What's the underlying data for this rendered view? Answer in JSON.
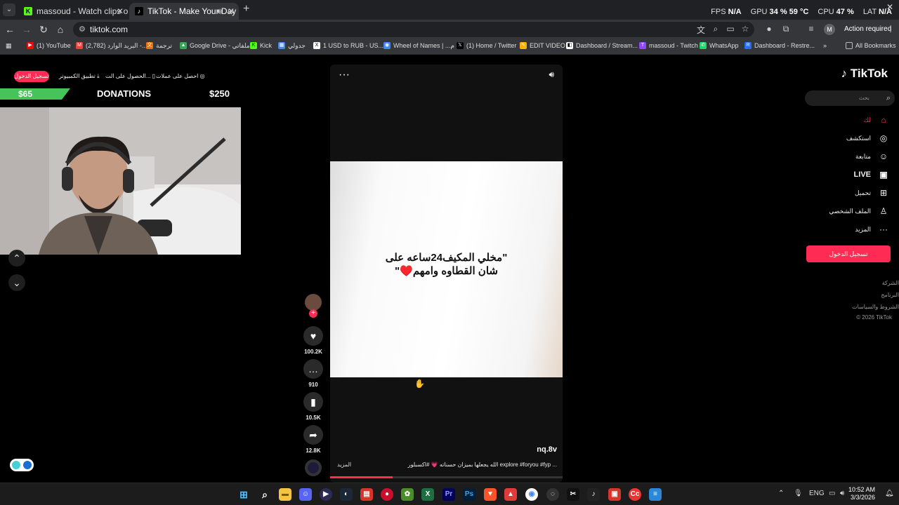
{
  "browser": {
    "tabs": [
      {
        "title": "massoud - Watch clips on Kick",
        "active": false,
        "favicon": "K"
      },
      {
        "title": "TikTok - Make Your Day",
        "active": true,
        "favicon": "♪"
      }
    ],
    "url": "tiktok.com",
    "action_required": "Action required",
    "profile_initial": "M",
    "bookmarks": [
      {
        "label": "(1) YouTube",
        "color": "#ff0000",
        "glyph": "▶"
      },
      {
        "label": "(2,782) البريد الوارد -...",
        "color": "#ea4335",
        "glyph": "M"
      },
      {
        "label": "ترجمة",
        "color": "#e8710a",
        "glyph": "文"
      },
      {
        "label": "Google Drive - ملفاتي",
        "color": "#34a853",
        "glyph": "▲"
      },
      {
        "label": "Kick",
        "color": "#53fc18",
        "glyph": "K"
      },
      {
        "label": "جدولي",
        "color": "#4285f4",
        "glyph": "▦"
      },
      {
        "label": "1 USD to RUB - US...",
        "color": "#ffffff",
        "glyph": "X"
      },
      {
        "label": "Wheel of Names | ...م",
        "color": "#4285f4",
        "glyph": "◉"
      },
      {
        "label": "(1) Home / Twitter",
        "color": "#000000",
        "glyph": "𝕏"
      },
      {
        "label": "EDIT VIDEO",
        "color": "#f4b400",
        "glyph": "✎"
      },
      {
        "label": "Dashboard / Stream...",
        "color": "#ffffff",
        "glyph": "◧"
      },
      {
        "label": "massoud - Twitch",
        "color": "#9146ff",
        "glyph": "T"
      },
      {
        "label": "WhatsApp",
        "color": "#25d366",
        "glyph": "✆"
      },
      {
        "label": "Dashboard - Restre...",
        "color": "#2d6cf6",
        "glyph": "R"
      }
    ],
    "all_bookmarks": "All Bookmarks"
  },
  "perf": {
    "fps_label": "FPS",
    "fps": "N/A",
    "gpu_label": "GPU",
    "gpu": "34 % 59 °C",
    "cpu_label": "CPU",
    "cpu": "47 %",
    "lat_label": "LAT",
    "lat": "N/A"
  },
  "overlay": {
    "signin": "تسجيل الدخول",
    "link1": "تطبيق الكمبيوتر",
    "link2": "الحصول على الت...",
    "link3": "احصل على عملات",
    "donation_current": "$65",
    "donation_title": "DONATIONS",
    "donation_goal": "$250",
    "donation_progress": 0.26
  },
  "video": {
    "caption_line1": "\"مخلي المكيف24ساعه على",
    "caption_line2": "شان القطاوه وامهم♥️\"",
    "username": "nq.8v",
    "description": "الله يجعلها بميزان حسناته 💗 #اكسبلور explore #foryou #fyp ...",
    "more": "المزيد",
    "progress": 0.27
  },
  "actions": {
    "likes": "100.2K",
    "comments": "910",
    "saves": "10.5K",
    "shares": "12.8K"
  },
  "tiktok_nav": {
    "logo": "TikTok",
    "search_placeholder": "بحث",
    "items": [
      {
        "label": "لك",
        "icon": "home-icon"
      },
      {
        "label": "استكشف",
        "icon": "compass-icon"
      },
      {
        "label": "متابعة",
        "icon": "following-icon"
      },
      {
        "label": "LIVE",
        "icon": "live-icon"
      },
      {
        "label": "تحميل",
        "icon": "upload-icon"
      },
      {
        "label": "الملف الشخصي",
        "icon": "profile-icon"
      },
      {
        "label": "المزيد",
        "icon": "more-icon"
      }
    ],
    "signin": "تسجيل الدخول",
    "footer": [
      "الشركة",
      "البرنامج",
      "الشروط والسياسات",
      "© 2026 TikTok"
    ]
  },
  "taskbar": {
    "lang": "ENG",
    "time": "10:52 AM",
    "date": "3/3/2026"
  }
}
